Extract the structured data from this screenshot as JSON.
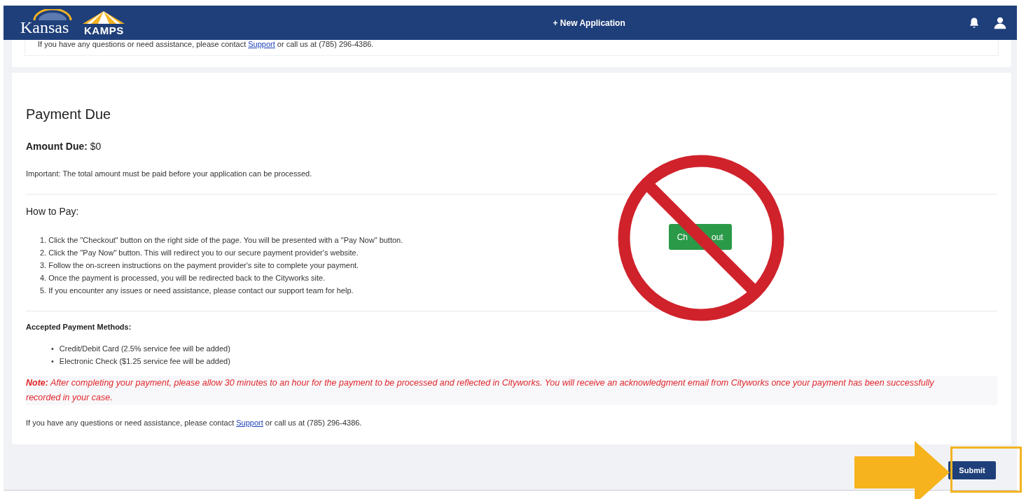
{
  "header": {
    "logo_text": "Kansas",
    "app_name": "KAMPS",
    "new_application": "+ New Application"
  },
  "previous_card": {
    "contact_before": "If you have any questions or need assistance, please contact ",
    "contact_link": "Support",
    "contact_after": " or call us at (785) 296-4386."
  },
  "payment": {
    "title": "Payment Due",
    "amount_label": "Amount Due:",
    "amount_value": "$0",
    "important": "Important: The total amount must be paid before your application can be processed.",
    "how_title": "How to Pay:",
    "steps": [
      "1. Click the \"Checkout\" button on the right side of the page. You will be presented with a \"Pay Now\" button.",
      "2. Click the \"Pay Now\" button. This will redirect you to our secure payment provider's website.",
      "3. Follow the on-screen instructions on the payment provider's site to complete your payment.",
      "4. Once the payment is processed, you will be redirected back to the Cityworks site.",
      "5. If you encounter any issues or need assistance, please contact our support team for help."
    ],
    "checkout_visible_parts": [
      "Ch",
      "out"
    ],
    "methods_title": "Accepted Payment Methods:",
    "methods": [
      {
        "bullet": "•",
        "text": "Credit/Debit Card (2.5% service fee will be added)"
      },
      {
        "bullet": "•",
        "text": "Electronic Check ($1.25 service fee will be added)"
      }
    ],
    "note": "**Note:** After completing your payment, please allow 30 minutes to an hour for the payment to be processed and reflected in Cityworks. You will receive an acknowledgment email from Cityworks once your payment has been successfully recorded in your case.",
    "contact_before": "If you have any questions or need assistance, please contact ",
    "contact_link": "Support",
    "contact_after": " or call us at (785) 296-4386."
  },
  "footer": {
    "submit": "Submit"
  }
}
